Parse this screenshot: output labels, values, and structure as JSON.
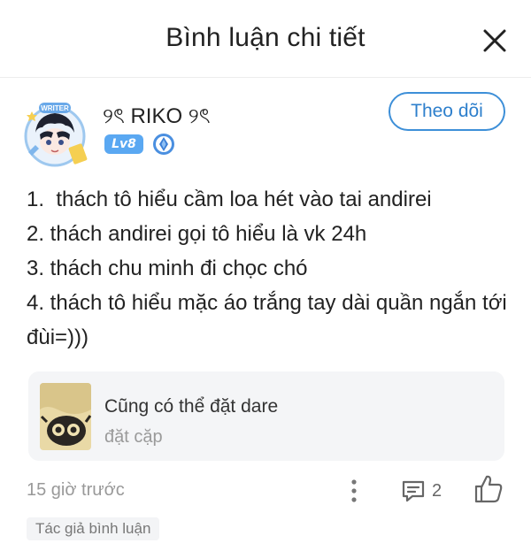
{
  "header": {
    "title": "Bình luận chi tiết"
  },
  "comment": {
    "username": "୨ৎ RIKO ୨ৎ",
    "avatar_frame_text": "WRITER",
    "level": "Lv8",
    "follow_label": "Theo dõi",
    "lines": [
      "1.  thách tô hiểu cầm loa hét vào tai andirei",
      "2. thách andirei gọi tô hiểu là vk 24h",
      "3. thách chu minh đi chọc chó",
      "4. thách tô hiểu mặc áo trắng tay dài quần ngắn tới đùi=)))"
    ],
    "reply": {
      "text": "Cũng có thể đặt dare",
      "subtitle": "đặt cặp"
    },
    "timestamp": "15 giờ trước",
    "reply_count": "2",
    "author_tag": "Tác giả bình luận"
  },
  "colors": {
    "accent": "#3d8fd8",
    "level_badge": "#5aa8f2",
    "card_bg": "#f4f5f7"
  },
  "icons": {
    "close": "close-icon",
    "more": "more-vertical-icon",
    "comment": "comment-icon",
    "like": "thumbs-up-icon",
    "rank": "rank-diamond-icon"
  }
}
